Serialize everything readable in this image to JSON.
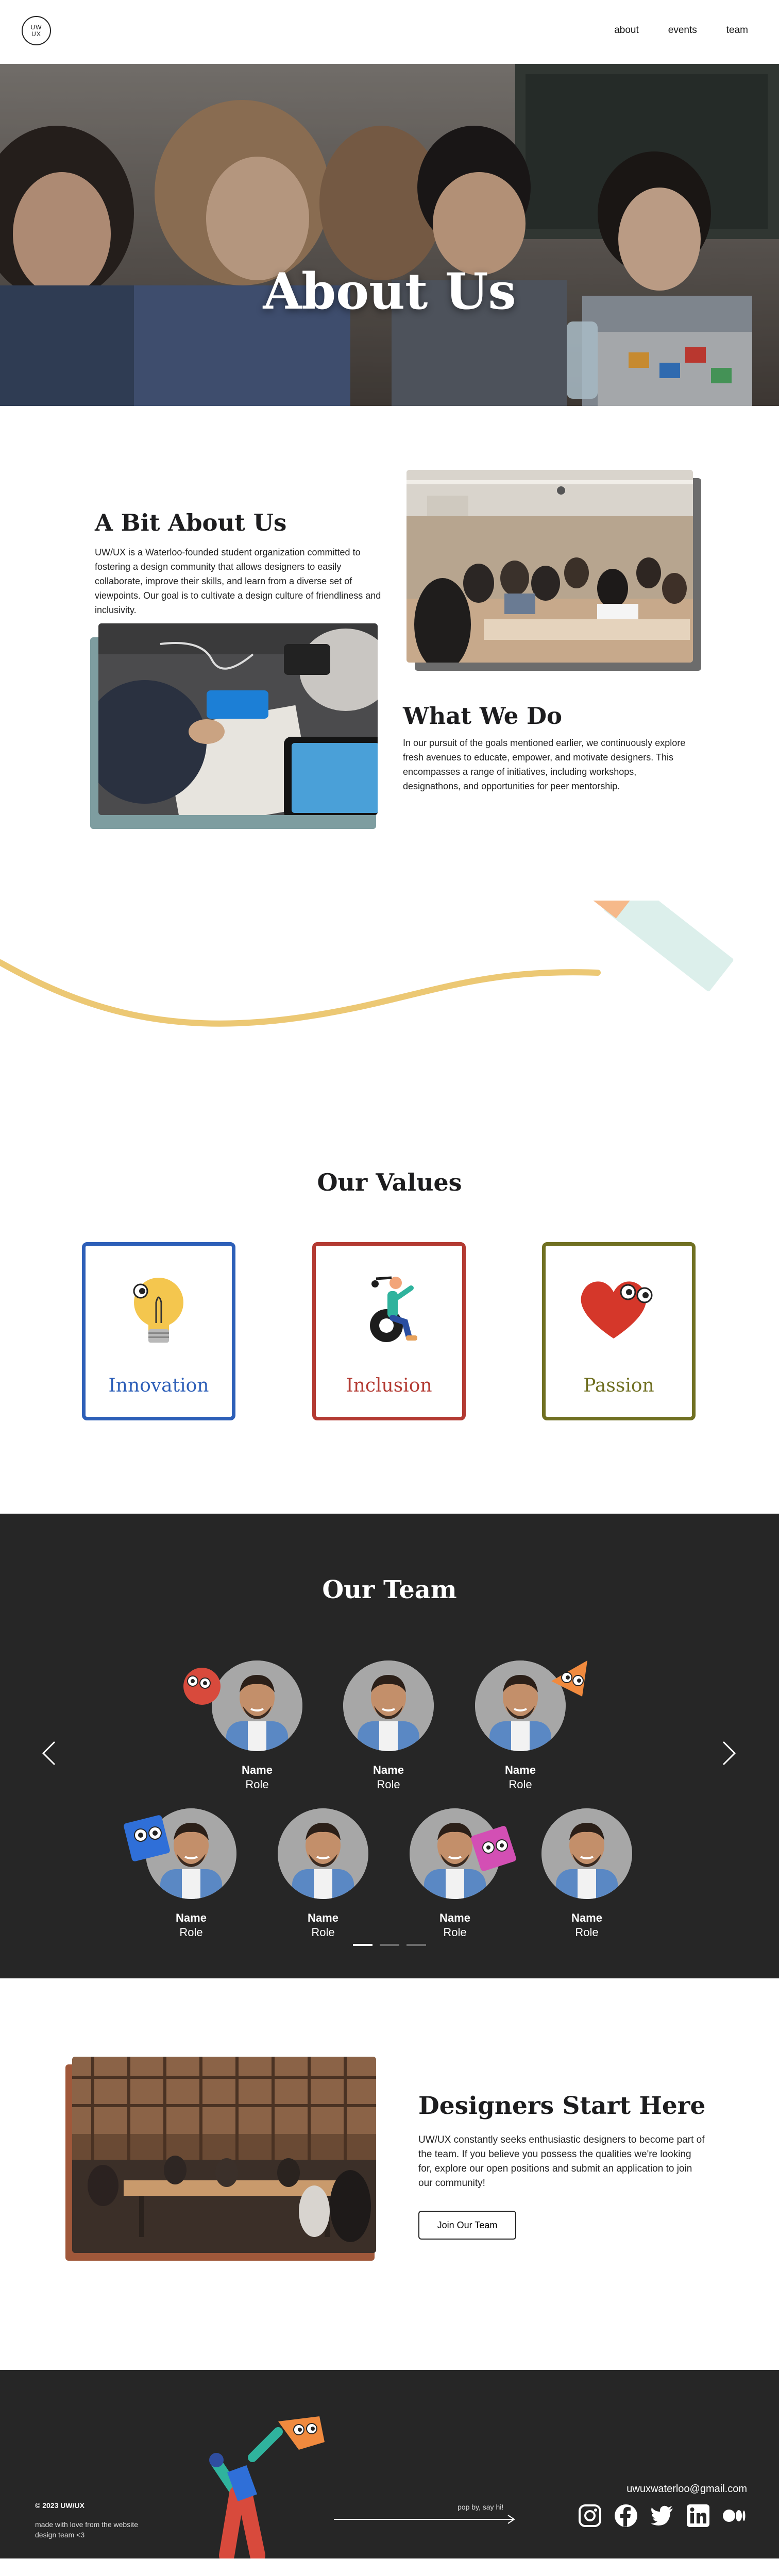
{
  "nav": {
    "logo_top": "UW",
    "logo_bottom": "UX",
    "links": [
      "about",
      "events",
      "team"
    ]
  },
  "hero": {
    "title": "About Us"
  },
  "about": {
    "heading": "A Bit About Us",
    "body": "UW/UX is a Waterloo-founded student organization committed to fostering a design community that allows designers to easily collaborate, improve their skills, and learn from a diverse set of viewpoints. Our goal is to cultivate a design culture of friendliness and inclusivity."
  },
  "what_we_do": {
    "heading": "What We Do",
    "body": "In our pursuit of the goals mentioned earlier, we continuously explore fresh avenues to educate, empower, and motivate designers. This encompasses a range of initiatives, including workshops, designathons, and opportunities for peer mentorship."
  },
  "values": {
    "heading": "Our Values",
    "items": [
      {
        "label": "Innovation",
        "color": "#2d5fb8",
        "icon": "lightbulb-icon"
      },
      {
        "label": "Inclusion",
        "color": "#b33a32",
        "icon": "wheelchair-icon"
      },
      {
        "label": "Passion",
        "color": "#707022",
        "icon": "heart-icon"
      }
    ]
  },
  "team": {
    "heading": "Our Team",
    "members": [
      {
        "name": "Name",
        "role": "Role"
      },
      {
        "name": "Name",
        "role": "Role"
      },
      {
        "name": "Name",
        "role": "Role"
      },
      {
        "name": "Name",
        "role": "Role"
      },
      {
        "name": "Name",
        "role": "Role"
      },
      {
        "name": "Name",
        "role": "Role"
      },
      {
        "name": "Name",
        "role": "Role"
      }
    ]
  },
  "join": {
    "heading": "Designers Start Here",
    "body": "UW/UX constantly seeks enthusiastic designers to become part of the team. If you believe you possess the qualities we're looking for, explore our open positions and submit an application to join our community!",
    "button": "Join Our Team"
  },
  "footer": {
    "copyright": "© 2023 UW/UX",
    "made_with": "made with love from the website design team <3",
    "pop_by": "pop by, say hi!",
    "email": "uwuxwaterloo@gmail.com",
    "socials": [
      "instagram-icon",
      "facebook-icon",
      "twitter-icon",
      "linkedin-icon",
      "medium-icon"
    ]
  },
  "colors": {
    "dark_bg": "#262626",
    "hero_overlay": "#514b46",
    "about_shadow": "#6c6c6c",
    "whatwedo_shadow": "#7e9da0",
    "join_shadow": "#a0583a",
    "squiggle": "#ecc874"
  }
}
